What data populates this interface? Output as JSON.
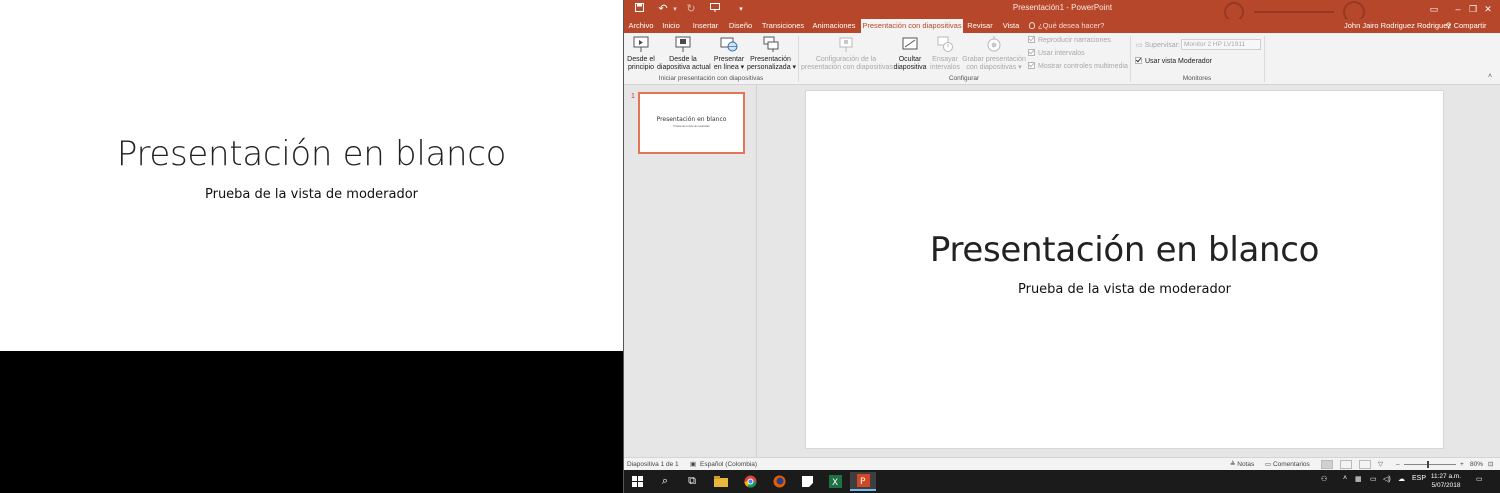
{
  "slideshow": {
    "title": "Presentación en blanco",
    "subtitle": "Prueba de la vista de moderador"
  },
  "window": {
    "title": "Presentación1 - PowerPoint",
    "user": "John Jairo Rodriguez Rodriguez",
    "share": "Compartir",
    "accent": "#b7472a"
  },
  "tabs": [
    {
      "label": "Archivo"
    },
    {
      "label": "Inicio"
    },
    {
      "label": "Insertar"
    },
    {
      "label": "Diseño"
    },
    {
      "label": "Transiciones"
    },
    {
      "label": "Animaciones"
    },
    {
      "label": "Presentación con diapositivas",
      "active": true
    },
    {
      "label": "Revisar"
    },
    {
      "label": "Vista"
    }
  ],
  "tell_me": "¿Qué desea hacer?",
  "ribbon": {
    "start_group": {
      "label": "Iniciar presentación con diapositivas",
      "buttons": [
        {
          "line1": "Desde el",
          "line2": "principio"
        },
        {
          "line1": "Desde la",
          "line2": "diapositiva actual"
        },
        {
          "line1": "Presentar",
          "line2": "en línea ▾"
        },
        {
          "line1": "Presentación",
          "line2": "personalizada ▾"
        }
      ]
    },
    "config_group": {
      "label": "Configurar",
      "buttons": [
        {
          "line1": "Configuración de la",
          "line2": "presentación con diapositivas"
        },
        {
          "line1": "Ocultar",
          "line2": "diapositiva"
        },
        {
          "line1": "Ensayar",
          "line2": "intervalos"
        },
        {
          "line1": "Grabar presentación",
          "line2": "con diapositivas ▾"
        }
      ],
      "checkboxes": [
        {
          "label": "Reproducir narraciones",
          "checked": true
        },
        {
          "label": "Usar intervalos",
          "checked": true
        },
        {
          "label": "Mostrar controles multimedia",
          "checked": true
        }
      ]
    },
    "monitors_group": {
      "label": "Monitores",
      "supervisar_label": "Supervisar:",
      "supervisar_value": "Monitor 2 HP LV1911",
      "presenter_view_label": "Usar vista Moderador",
      "presenter_view_checked": true
    }
  },
  "thumbnail": {
    "number": "1",
    "title": "Presentación en blanco",
    "subtitle": "Prueba de la vista de moderador"
  },
  "slide": {
    "title": "Presentación en blanco",
    "subtitle": "Prueba de la vista de moderador"
  },
  "status": {
    "slide_count": "Diapositiva 1 de 1",
    "language": "Español (Colombia)",
    "notes": "Notas",
    "comments": "Comentarios",
    "zoom": "80%",
    "zoom_minus": "–",
    "zoom_plus": "+"
  },
  "taskbar": {
    "time": "11:27 a.m.",
    "date": "5/07/2018",
    "language": "ESP"
  }
}
